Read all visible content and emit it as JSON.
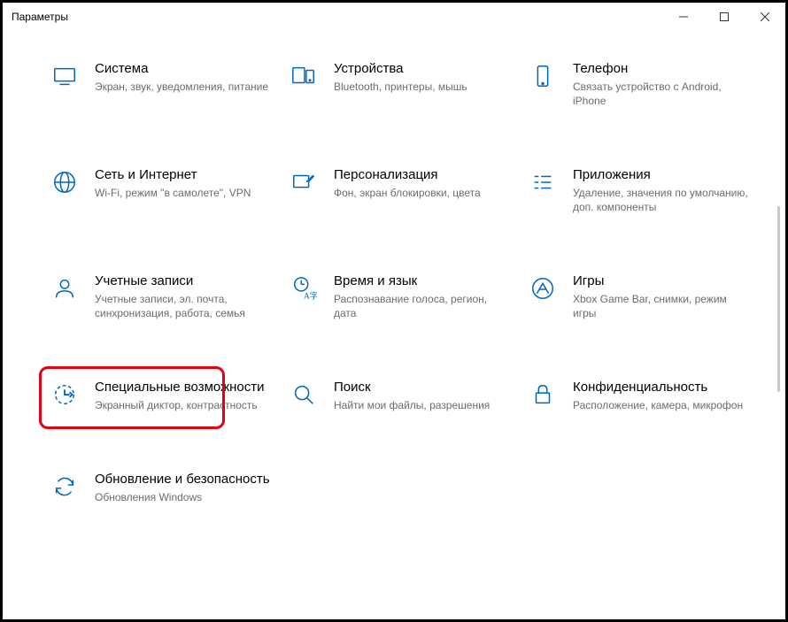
{
  "window": {
    "title": "Параметры"
  },
  "tiles": [
    {
      "id": "system",
      "title": "Система",
      "desc": "Экран, звук, уведомления, питание"
    },
    {
      "id": "devices",
      "title": "Устройства",
      "desc": "Bluetooth, принтеры, мышь"
    },
    {
      "id": "phone",
      "title": "Телефон",
      "desc": "Связать устройство с Android, iPhone"
    },
    {
      "id": "network",
      "title": "Сеть и Интернет",
      "desc": "Wi-Fi, режим \"в самолете\", VPN"
    },
    {
      "id": "personalization",
      "title": "Персонализация",
      "desc": "Фон, экран блокировки, цвета"
    },
    {
      "id": "apps",
      "title": "Приложения",
      "desc": "Удаление, значения по умолчанию, доп. компоненты"
    },
    {
      "id": "accounts",
      "title": "Учетные записи",
      "desc": "Учетные записи, эл. почта, синхронизация, работа, семья"
    },
    {
      "id": "time",
      "title": "Время и язык",
      "desc": "Распознавание голоса, регион, дата"
    },
    {
      "id": "gaming",
      "title": "Игры",
      "desc": "Xbox Game Bar, снимки, режим игры"
    },
    {
      "id": "ease",
      "title": "Специальные возможности",
      "desc": "Экранный диктор, контрастность"
    },
    {
      "id": "search",
      "title": "Поиск",
      "desc": "Найти мои файлы, разрешения"
    },
    {
      "id": "privacy",
      "title": "Конфиденциальность",
      "desc": "Расположение, камера, микрофон"
    },
    {
      "id": "update",
      "title": "Обновление и безопасность",
      "desc": "Обновления Windows"
    }
  ],
  "highlight_index": 9
}
